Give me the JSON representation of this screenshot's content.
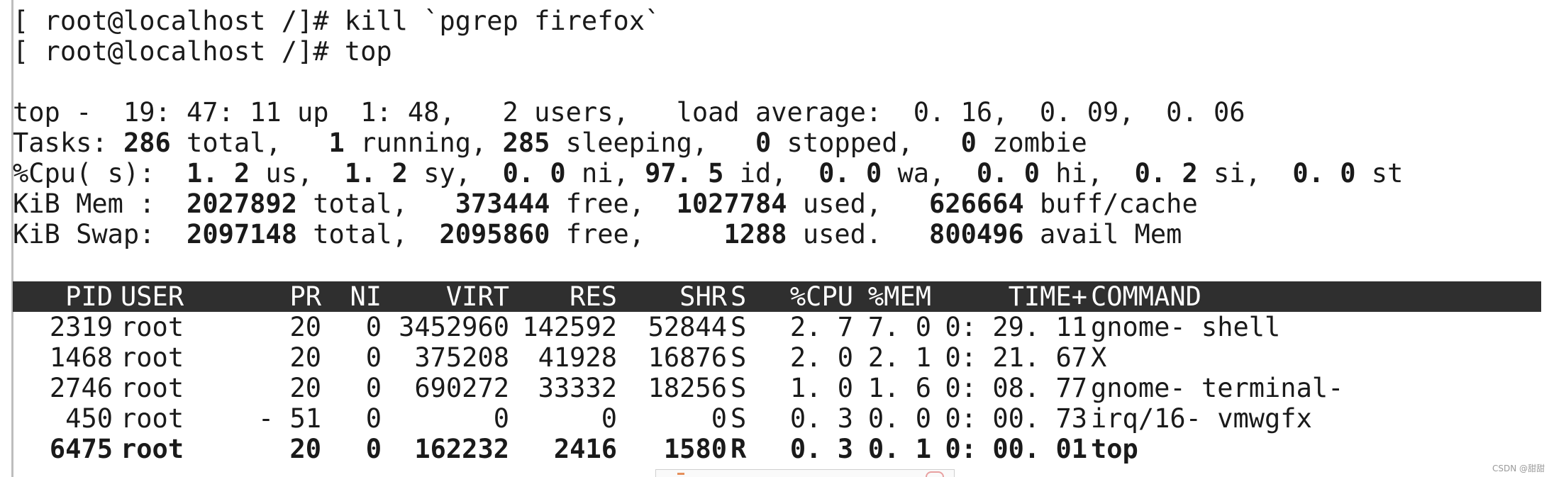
{
  "terminal": {
    "lines": {
      "cmd1": "[ root@localhost /]# kill `pgrep firefox`",
      "cmd2": "[ root@localhost /]# top"
    },
    "summary": {
      "top_line": "top -  19: 47: 11 up  1: 48,   2 users,   load average:  0. 16,  0. 09,  0. 06",
      "tasks": {
        "label": "Tasks: ",
        "total": "286",
        "total_label": " total,   ",
        "running": "1",
        "running_label": " running, ",
        "sleeping": "285",
        "sleeping_label": " sleeping,   ",
        "stopped": "0",
        "stopped_label": " stopped,   ",
        "zombie": "0",
        "zombie_label": " zombie"
      },
      "cpu": {
        "label": "%Cpu( s):  ",
        "us": "1. 2",
        "us_label": " us,  ",
        "sy": "1. 2",
        "sy_label": " sy,  ",
        "ni": "0. 0",
        "ni_label": " ni, ",
        "id": "97. 5",
        "id_label": " id,  ",
        "wa": "0. 0",
        "wa_label": " wa,  ",
        "hi": "0. 0",
        "hi_label": " hi,  ",
        "si": "0. 2",
        "si_label": " si,  ",
        "st": "0. 0",
        "st_label": " st"
      },
      "mem": {
        "label": "KiB Mem :  ",
        "total": "2027892",
        "total_label": " total,   ",
        "free": "373444",
        "free_label": " free,  ",
        "used": "1027784",
        "used_label": " used,   ",
        "buff": "626664",
        "buff_label": " buff/cache"
      },
      "swap": {
        "label": "KiB Swap:  ",
        "total": "2097148",
        "total_label": " total,  ",
        "free": "2095860",
        "free_label": " free,     ",
        "used": "1288",
        "used_label": " used.   ",
        "avail": "800496",
        "avail_label": " avail Mem"
      }
    },
    "table": {
      "headers": {
        "pid": "PID",
        "user": "USER",
        "pr": "PR",
        "ni": "NI",
        "virt": "VIRT",
        "res": "RES",
        "shr": "SHR",
        "s": "S",
        "cpu": "%CPU",
        "mem": "%MEM",
        "time": "TIME+",
        "command": "COMMAND"
      },
      "rows": [
        {
          "pid": "2319",
          "user": "root",
          "pr": "20",
          "ni": "0",
          "virt": "3452960",
          "res": "142592",
          "shr": "52844",
          "s": "S",
          "cpu": "2. 7",
          "mem": "7. 0",
          "time": "0: 29. 11",
          "command": "gnome- shell"
        },
        {
          "pid": "1468",
          "user": "root",
          "pr": "20",
          "ni": "0",
          "virt": "375208",
          "res": "41928",
          "shr": "16876",
          "s": "S",
          "cpu": "2. 0",
          "mem": "2. 1",
          "time": "0: 21. 67",
          "command": "X"
        },
        {
          "pid": "2746",
          "user": "root",
          "pr": "20",
          "ni": "0",
          "virt": "690272",
          "res": "33332",
          "shr": "18256",
          "s": "S",
          "cpu": "1. 0",
          "mem": "1. 6",
          "time": "0: 08. 77",
          "command": "gnome- terminal-"
        },
        {
          "pid": "450",
          "user": "root",
          "pr": "- 51",
          "ni": "0",
          "virt": "0",
          "res": "0",
          "shr": "0",
          "s": "S",
          "cpu": "0. 3",
          "mem": "0. 0",
          "time": "0: 00. 73",
          "command": "irq/16- vmwgfx"
        },
        {
          "pid": "6475",
          "user": "root",
          "pr": "20",
          "ni": "0",
          "virt": "162232",
          "res": "2416",
          "shr": "1580",
          "s": "R",
          "cpu": "0. 3",
          "mem": "0. 1",
          "time": "0: 00. 01",
          "command": "top"
        }
      ]
    }
  },
  "watermark": "CSDN @甜甜"
}
